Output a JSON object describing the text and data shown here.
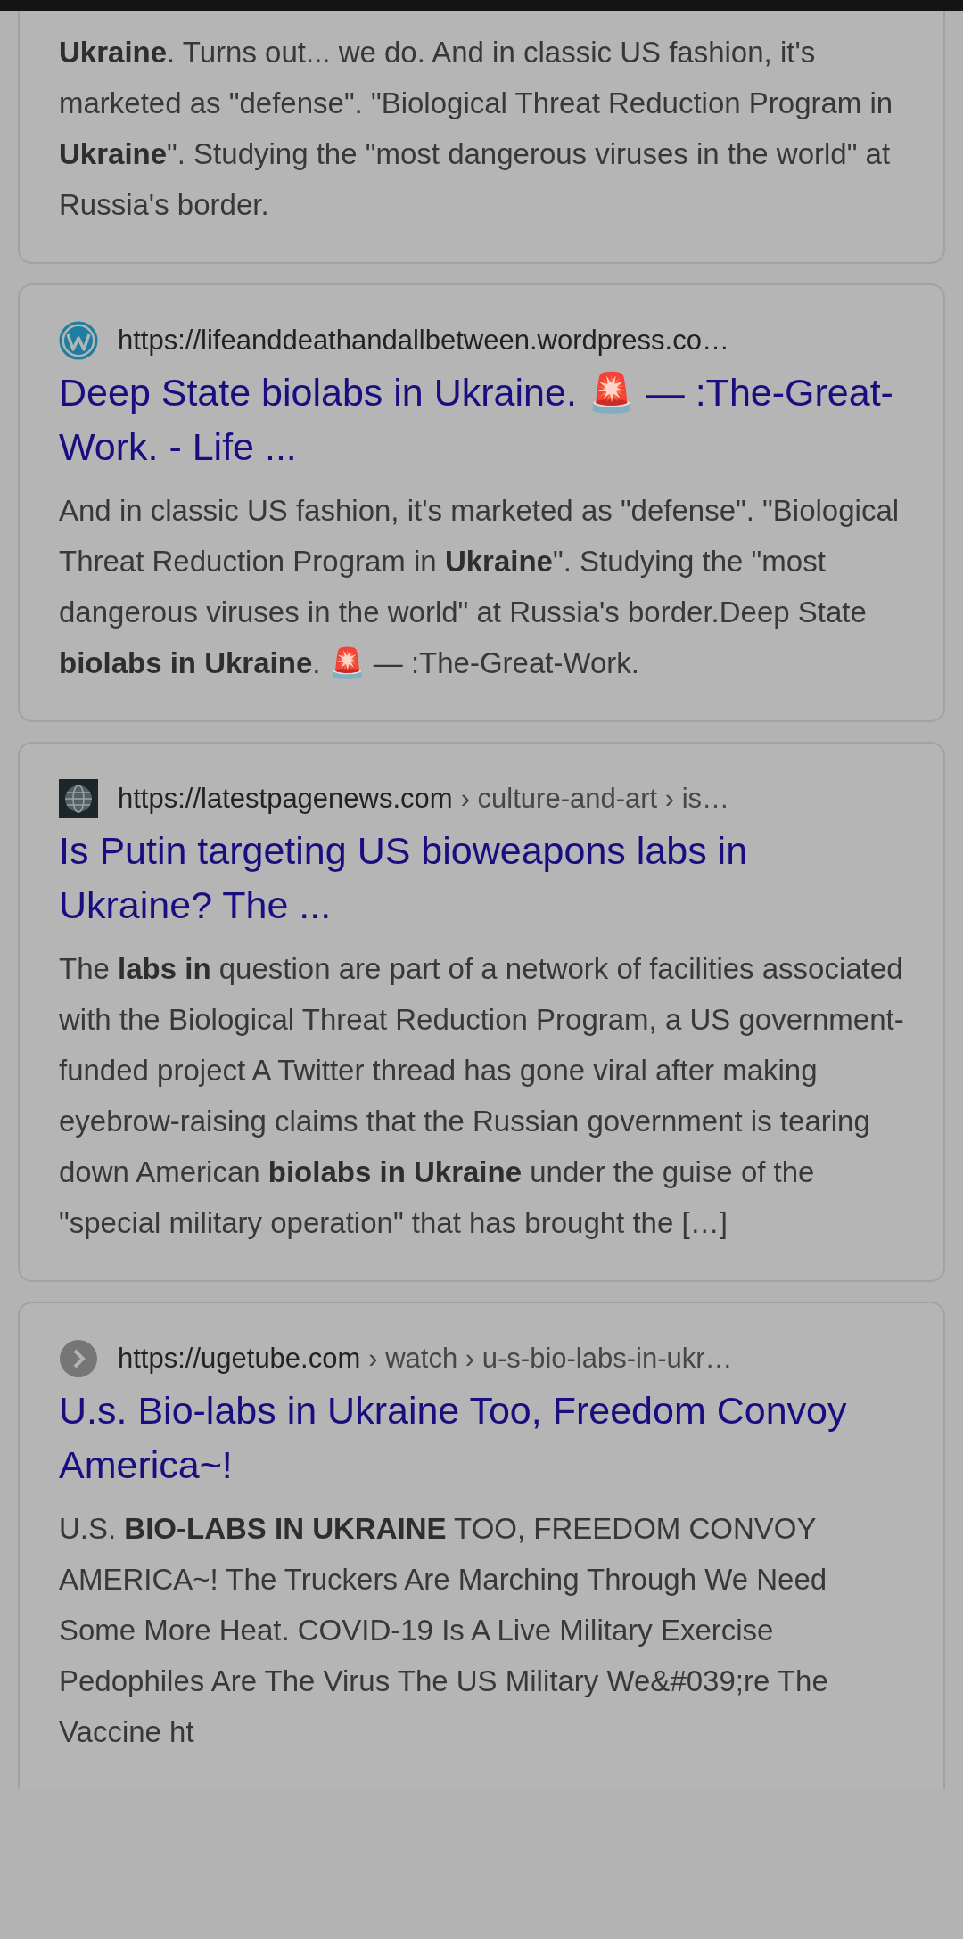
{
  "results": [
    {
      "snippet": "**Ukraine**. Turns out... we do. And in classic US fashion, it's marketed as \"defense\". \"Biological Threat Reduction Program in **Ukraine**\". Studying the \"most dangerous viruses in the world\" at Russia's border."
    },
    {
      "favicon": {
        "kind": "wordpress"
      },
      "domain": "https://lifeanddeathandallbetween.wordpress.co…",
      "title": "Deep State biolabs in Ukraine. 🚨 — :The-Great-Work. - Life ...",
      "snippet": "And in classic US fashion, it's marketed as \"defense\". \"Biological Threat Reduction Program in **Ukraine**\". Studying the \"most dangerous viruses in the world\" at Russia's border.Deep State **biolabs in Ukraine**. 🚨 — :The-Great-Work."
    },
    {
      "favicon": {
        "kind": "news"
      },
      "domain": "https://latestpagenews.com",
      "path": "› culture-and-art › is…",
      "title": "Is Putin targeting US bioweapons labs in Ukraine? The ...",
      "snippet": "The **labs in** question are part of a network of facilities associated with the Biological Threat Reduction Program, a US government-funded project A Twitter thread has gone viral after making eyebrow-raising claims that the Russian government is tearing down American **biolabs in Ukraine** under the guise of the \"special military operation\" that has brought the […]"
    },
    {
      "favicon": {
        "kind": "chevron"
      },
      "domain": "https://ugetube.com",
      "path": "› watch › u-s-bio-labs-in-ukr…",
      "title": "U.s. Bio-labs in Ukraine Too, Freedom Convoy America~!",
      "snippet": "U.S. **BIO-LABS IN UKRAINE** TOO, FREEDOM CONVOY AMERICA~! The Truckers Are Marching Through We Need Some More Heat. COVID-19 Is A Live Military Exercise Pedophiles Are The Virus The US Military We&#039;re The Vaccine ht"
    }
  ]
}
